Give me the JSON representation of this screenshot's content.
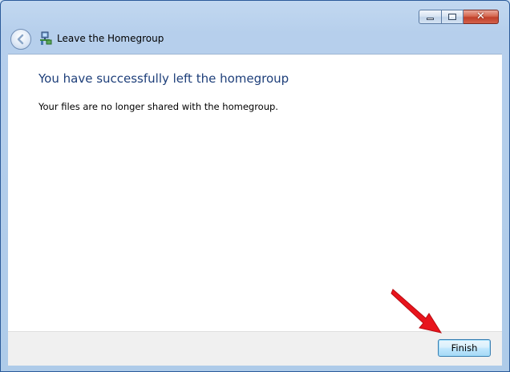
{
  "window": {
    "title": "Leave the Homegroup",
    "caption_buttons": {
      "minimize": "minimize",
      "maximize": "maximize",
      "close": "✕"
    }
  },
  "content": {
    "heading": "You have successfully left the homegroup",
    "message": "Your files are no longer shared with the homegroup."
  },
  "footer": {
    "finish_label": "Finish"
  },
  "icons": {
    "back": "back-arrow-icon",
    "homegroup": "homegroup-icon",
    "annotation": "red-arrow-icon"
  },
  "colors": {
    "heading": "#1e3f7a",
    "annotation_arrow": "#e8141c",
    "window_frame": "#aecbe9"
  }
}
